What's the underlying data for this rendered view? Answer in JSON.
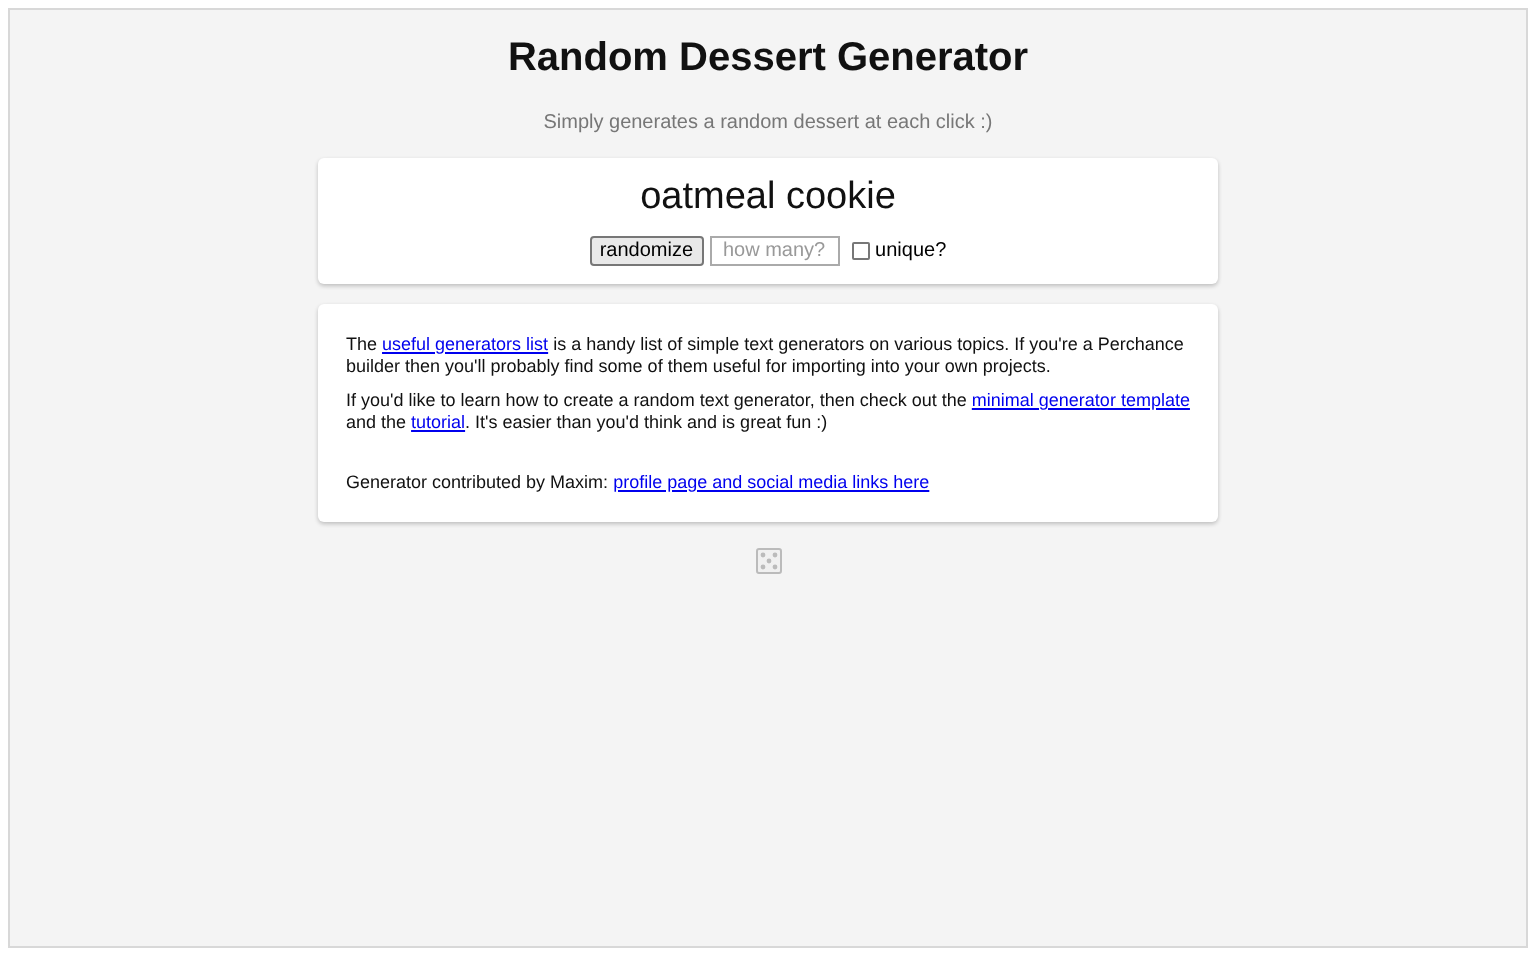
{
  "title": "Random Dessert Generator",
  "subtitle": "Simply generates a random dessert at each click :)",
  "result": "oatmeal cookie",
  "controls": {
    "button": "randomize",
    "count_field": {
      "placeholder": "how many?"
    },
    "unique": {
      "label": "unique?",
      "checked": false
    }
  },
  "info": [
    [
      {
        "kind": "text",
        "text": "The "
      },
      {
        "kind": "link",
        "text": "useful generators list"
      },
      {
        "kind": "text",
        "text": " is a handy list of simple text generators on various topics. If you're a Perchance builder then you'll probably find some of them useful for importing into your own projects."
      }
    ],
    [
      {
        "kind": "text",
        "text": "If you'd like to learn how to create a random text generator, then check out the "
      },
      {
        "kind": "link",
        "text": "minimal generator template"
      },
      {
        "kind": "text",
        "text": " and the "
      },
      {
        "kind": "link",
        "text": "tutorial"
      },
      {
        "kind": "text",
        "text": ". It's easier than you'd think and is great fun :)"
      }
    ],
    [
      {
        "kind": "text",
        "text": "Generator contributed by Maxim: "
      },
      {
        "kind": "link",
        "text": "profile page and social media links here"
      }
    ]
  ]
}
